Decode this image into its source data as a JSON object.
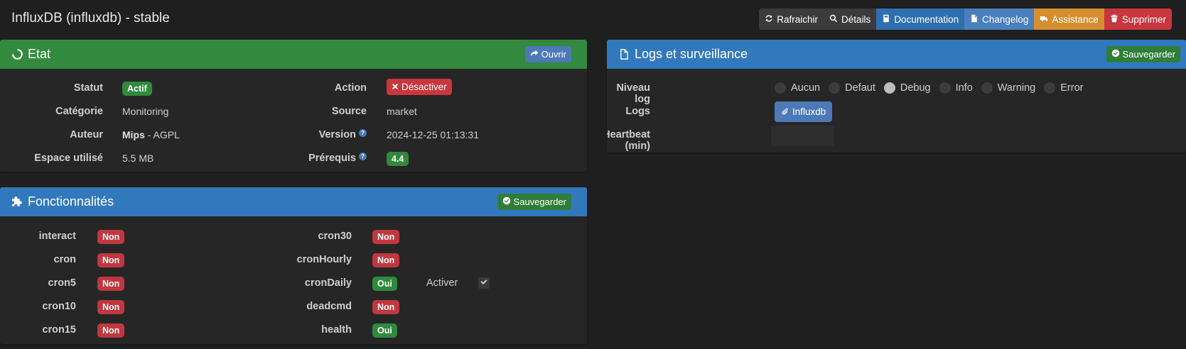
{
  "page": {
    "title": "InfluxDB (influxdb) - stable"
  },
  "toolbar": {
    "refresh": "Rafraichir",
    "details": "Détails",
    "documentation": "Documentation",
    "changelog": "Changelog",
    "assistance": "Assistance",
    "delete": "Supprimer"
  },
  "etat": {
    "title": "Etat",
    "open_label": "Ouvrir",
    "statut_label": "Statut",
    "statut_value": "Actif",
    "categorie_label": "Catégorie",
    "categorie_value": "Monitoring",
    "auteur_label": "Auteur",
    "auteur_name": "Mips",
    "auteur_license": " - AGPL",
    "espace_label": "Espace utilisé",
    "espace_value": "5.5 MB",
    "action_label": "Action",
    "action_button": "Désactiver",
    "source_label": "Source",
    "source_value": "market",
    "version_label": "Version",
    "version_value": "2024-12-25 01:13:31",
    "prerequis_label": "Prérequis",
    "prerequis_value": "4.4"
  },
  "logs": {
    "title": "Logs et surveillance",
    "save_label": "Sauvegarder",
    "niveau_label": "Niveau log",
    "levels": [
      "Aucun",
      "Defaut",
      "Debug",
      "Info",
      "Warning",
      "Error"
    ],
    "selected_level": "Debug",
    "logs_label": "Logs",
    "logs_button": "Influxdb",
    "heartbeat_label": "Heartbeat (min)",
    "heartbeat_value": ""
  },
  "fonctionnalites": {
    "title": "Fonctionnalités",
    "save_label": "Sauvegarder",
    "left": [
      {
        "name": "interact",
        "value": "Non"
      },
      {
        "name": "cron",
        "value": "Non"
      },
      {
        "name": "cron5",
        "value": "Non"
      },
      {
        "name": "cron10",
        "value": "Non"
      },
      {
        "name": "cron15",
        "value": "Non"
      }
    ],
    "right": [
      {
        "name": "cron30",
        "value": "Non"
      },
      {
        "name": "cronHourly",
        "value": "Non"
      },
      {
        "name": "cronDaily",
        "value": "Oui"
      },
      {
        "name": "deadcmd",
        "value": "Non"
      },
      {
        "name": "health",
        "value": "Oui"
      }
    ],
    "activer_label": "Activer",
    "activer_checked": true
  },
  "colors": {
    "green_header": "#338a3f",
    "blue_header": "#3278bd",
    "badge_green": "#2f8a3c",
    "badge_red": "#c1373f"
  }
}
